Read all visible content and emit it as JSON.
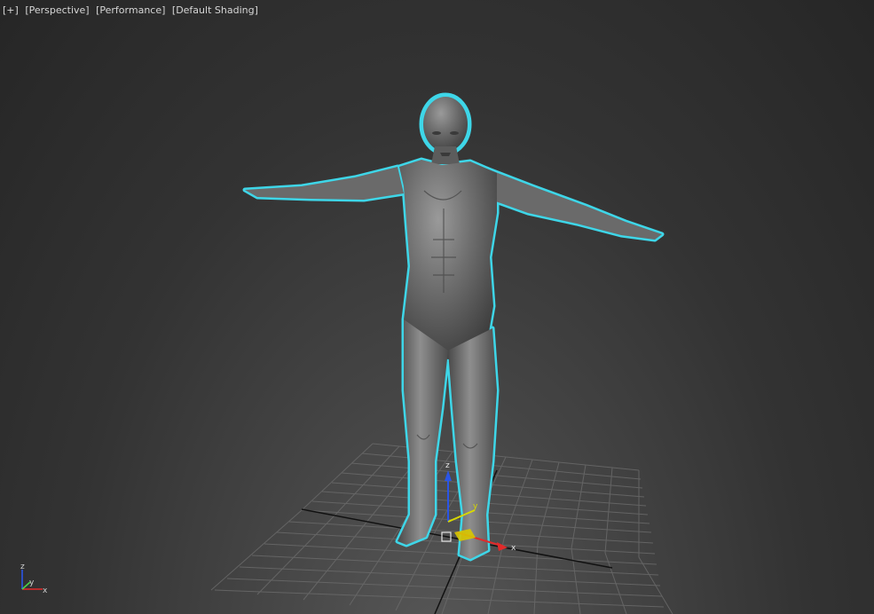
{
  "viewport": {
    "labels": [
      "[+]",
      "[Perspective]",
      "[Performance]",
      "[Default Shading]"
    ],
    "selection_color": "#3ed6e8",
    "grid_color": "#6a6a6a"
  },
  "gizmo": {
    "x_label": "x",
    "y_label": "y",
    "z_label": "z",
    "x_color": "#e22a2a",
    "y_color": "#d8d800",
    "z_color": "#2a55e6"
  },
  "view_cube_axes": {
    "x_label": "x",
    "y_label": "y",
    "z_label": "z"
  }
}
